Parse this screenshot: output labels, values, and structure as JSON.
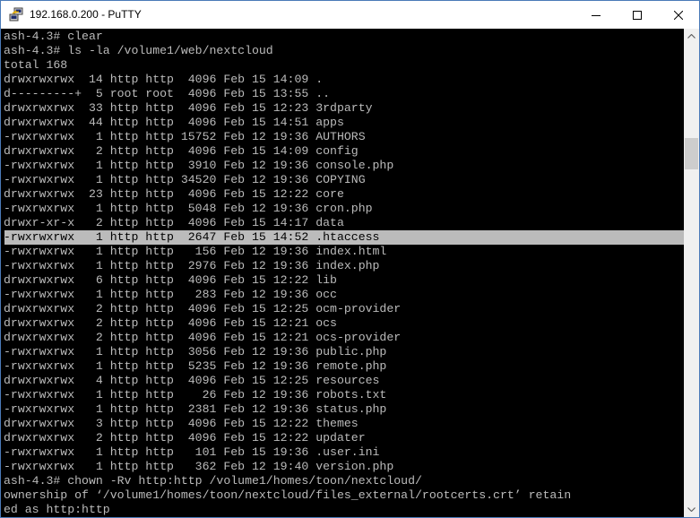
{
  "window": {
    "title": "192.168.0.200 - PuTTY",
    "icon": "putty-icon"
  },
  "controls": {
    "minimize": "minimize-icon",
    "maximize": "maximize-icon",
    "close": "close-icon"
  },
  "terminal": {
    "highlighted_line": 14,
    "lines": [
      "ash-4.3# clear",
      "ash-4.3# ls -la /volume1/web/nextcloud",
      "total 168",
      "drwxrwxrwx  14 http http  4096 Feb 15 14:09 .",
      "d---------+  5 root root  4096 Feb 15 13:55 ..",
      "drwxrwxrwx  33 http http  4096 Feb 15 12:23 3rdparty",
      "drwxrwxrwx  44 http http  4096 Feb 15 14:51 apps",
      "-rwxrwxrwx   1 http http 15752 Feb 12 19:36 AUTHORS",
      "drwxrwxrwx   2 http http  4096 Feb 15 14:09 config",
      "-rwxrwxrwx   1 http http  3910 Feb 12 19:36 console.php",
      "-rwxrwxrwx   1 http http 34520 Feb 12 19:36 COPYING",
      "drwxrwxrwx  23 http http  4096 Feb 15 12:22 core",
      "-rwxrwxrwx   1 http http  5048 Feb 12 19:36 cron.php",
      "drwxr-xr-x   2 http http  4096 Feb 15 14:17 data",
      "-rwxrwxrwx   1 http http  2647 Feb 15 14:52 .htaccess",
      "-rwxrwxrwx   1 http http   156 Feb 12 19:36 index.html",
      "-rwxrwxrwx   1 http http  2976 Feb 12 19:36 index.php",
      "drwxrwxrwx   6 http http  4096 Feb 15 12:22 lib",
      "-rwxrwxrwx   1 http http   283 Feb 12 19:36 occ",
      "drwxrwxrwx   2 http http  4096 Feb 15 12:25 ocm-provider",
      "drwxrwxrwx   2 http http  4096 Feb 15 12:21 ocs",
      "drwxrwxrwx   2 http http  4096 Feb 15 12:21 ocs-provider",
      "-rwxrwxrwx   1 http http  3056 Feb 12 19:36 public.php",
      "-rwxrwxrwx   1 http http  5235 Feb 12 19:36 remote.php",
      "drwxrwxrwx   4 http http  4096 Feb 15 12:25 resources",
      "-rwxrwxrwx   1 http http    26 Feb 12 19:36 robots.txt",
      "-rwxrwxrwx   1 http http  2381 Feb 12 19:36 status.php",
      "drwxrwxrwx   3 http http  4096 Feb 15 12:22 themes",
      "drwxrwxrwx   2 http http  4096 Feb 15 12:22 updater",
      "-rwxrwxrwx   1 http http   101 Feb 15 19:36 .user.ini",
      "-rwxrwxrwx   1 http http   362 Feb 12 19:40 version.php",
      "ash-4.3# chown -Rv http:http /volume1/homes/toon/nextcloud/",
      "ownership of ‘/volume1/homes/toon/nextcloud/files_external/rootcerts.crt’ retain",
      "ed as http:http"
    ]
  }
}
